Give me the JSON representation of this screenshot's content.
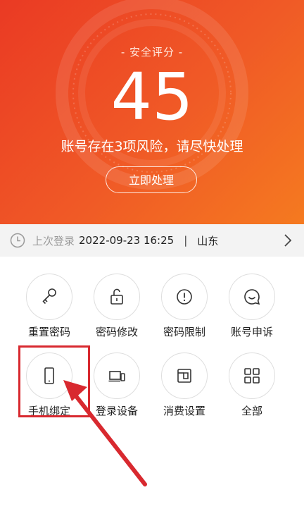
{
  "hero": {
    "score_label": "- 安全评分 -",
    "score": "45",
    "risk_text": "账号存在3项风险，请尽快处理",
    "action_button": "立即处理"
  },
  "login": {
    "label": "上次登录",
    "time": "2022-09-23 16:25",
    "separator": "|",
    "location": "山东"
  },
  "grid": {
    "items": [
      {
        "label": "重置密码",
        "icon": "key-icon"
      },
      {
        "label": "密码修改",
        "icon": "unlock-icon"
      },
      {
        "label": "密码限制",
        "icon": "alert-icon"
      },
      {
        "label": "账号申诉",
        "icon": "chat-icon"
      },
      {
        "label": "手机绑定",
        "icon": "phone-icon"
      },
      {
        "label": "登录设备",
        "icon": "devices-icon"
      },
      {
        "label": "消费设置",
        "icon": "wallet-icon"
      },
      {
        "label": "全部",
        "icon": "grid-icon"
      }
    ]
  },
  "colors": {
    "hero_start": "#ea3a24",
    "hero_end": "#f57a20",
    "annotation_red": "#d8292f"
  }
}
